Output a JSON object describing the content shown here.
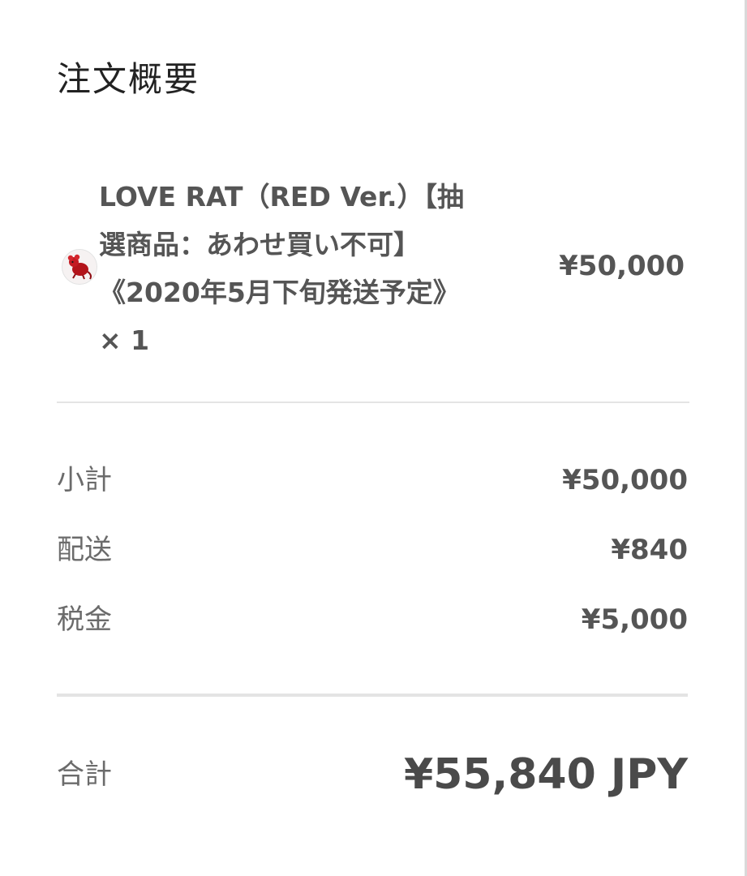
{
  "summary": {
    "title": "注文概要"
  },
  "item": {
    "thumbnail_icon": "red-rat-product-thumbnail",
    "name_lines": [
      "LOVE RAT（RED Ver.）【抽",
      "選商品：あわせ買い不可】",
      "《2020年5月下旬発送予定》"
    ],
    "quantity": "× 1",
    "price": "¥50,000"
  },
  "costs": {
    "subtotal_label": "小計",
    "subtotal_value": "¥50,000",
    "shipping_label": "配送",
    "shipping_value": "¥840",
    "tax_label": "税金",
    "tax_value": "¥5,000"
  },
  "total": {
    "label": "合計",
    "value": "¥55,840 JPY"
  }
}
